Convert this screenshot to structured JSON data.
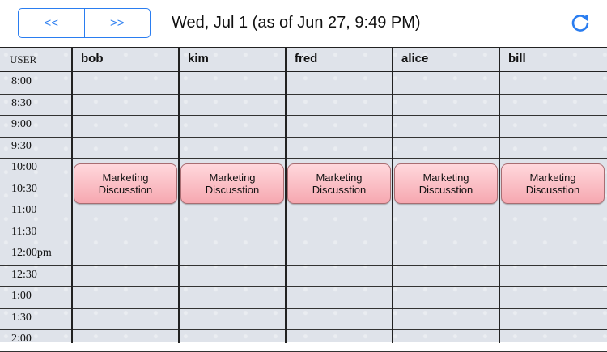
{
  "nav": {
    "prev_label": "<<",
    "next_label": ">>"
  },
  "header": {
    "date_title": "Wed, Jul 1 (as of Jun 27, 9:49 PM)"
  },
  "grid": {
    "user_header": "USER",
    "users": [
      "bob",
      "kim",
      "fred",
      "alice",
      "bill"
    ],
    "times": [
      "8:00",
      "8:30",
      "9:00",
      "9:30",
      "10:00",
      "10:30",
      "11:00",
      "11:30",
      "12:00pm",
      "12:30",
      "1:00",
      "1:30",
      "2:00"
    ]
  },
  "events": [
    {
      "user": "bob",
      "title": "Marketing Discusstion",
      "start": "10:00",
      "end": "11:00"
    },
    {
      "user": "kim",
      "title": "Marketing Discusstion",
      "start": "10:00",
      "end": "11:00"
    },
    {
      "user": "fred",
      "title": "Marketing Discusstion",
      "start": "10:00",
      "end": "11:00"
    },
    {
      "user": "alice",
      "title": "Marketing Discusstion",
      "start": "10:00",
      "end": "11:00"
    },
    {
      "user": "bill",
      "title": "Marketing Discusstion",
      "start": "10:00",
      "end": "11:00"
    }
  ],
  "colors": {
    "accent": "#2a7df0",
    "event_fill": "#f6a8b0"
  },
  "icons": {
    "refresh": "refresh-icon"
  }
}
